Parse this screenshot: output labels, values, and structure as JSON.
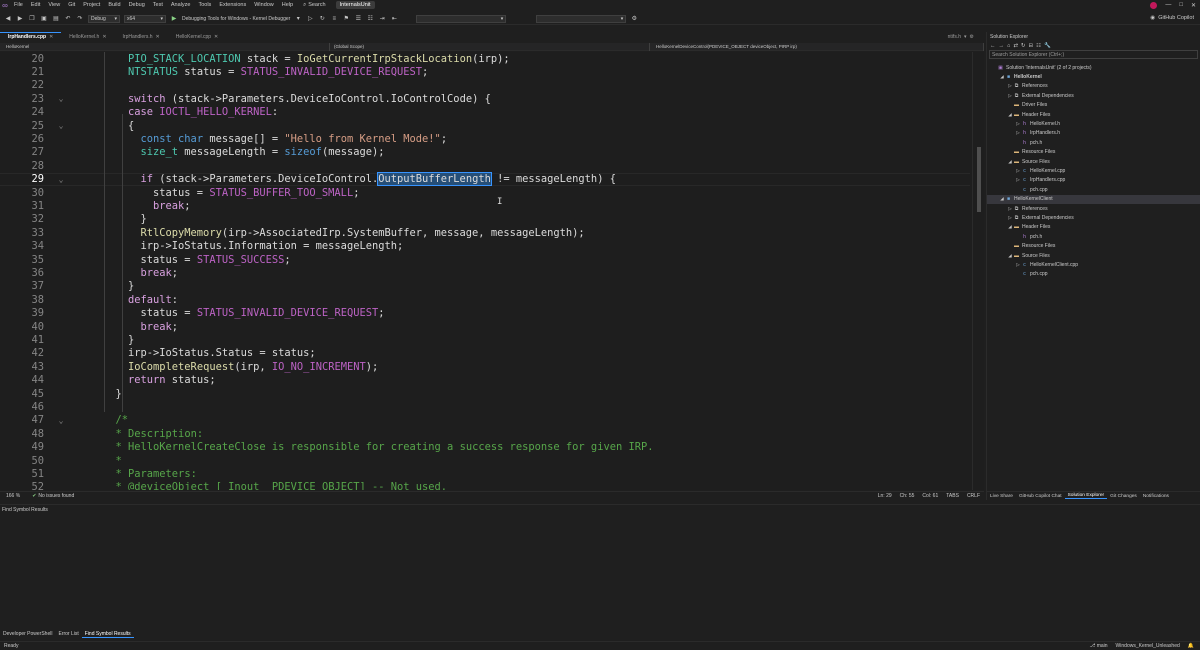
{
  "menubar": {
    "items": [
      "File",
      "Edit",
      "View",
      "Git",
      "Project",
      "Build",
      "Debug",
      "Test",
      "Analyze",
      "Tools",
      "Extensions",
      "Window",
      "Help"
    ],
    "search_label": "Search",
    "solution_name": "InternalsUnit"
  },
  "toolbar": {
    "config": "Debug",
    "platform": "x64",
    "debug_target": "Debugging Tools for Windows - Kernel Debugger",
    "copilot_label": "GitHub Copilot"
  },
  "doc_tabs": {
    "tabs": [
      {
        "label": "IrpHandlers.cpp",
        "active": true
      },
      {
        "label": "HelloKernel.h",
        "active": false
      },
      {
        "label": "IrpHandlers.h",
        "active": false
      },
      {
        "label": "HelloKernel.cpp",
        "active": false
      }
    ],
    "right_label": "ntifs.h"
  },
  "navbar": {
    "project": "HelloKernel",
    "scope": "(Global Scope)",
    "member": "HelloKernelDeviceControl(PDEVICE_OBJECT deviceObject, PIRP irp)"
  },
  "editor": {
    "current_line": "29",
    "lines": [
      {
        "n": "20",
        "tokens": [
          [
            "ty",
            "PIO_STACK_LOCATION"
          ],
          [
            "code",
            " stack = "
          ],
          [
            "fn",
            "IoGetCurrentIrpStackLocation"
          ],
          [
            "code",
            "(irp);"
          ]
        ]
      },
      {
        "n": "21",
        "tokens": [
          [
            "ty",
            "NTSTATUS"
          ],
          [
            "code",
            " status = "
          ],
          [
            "mac",
            "STATUS_INVALID_DEVICE_REQUEST"
          ],
          [
            "code",
            ";"
          ]
        ]
      },
      {
        "n": "22",
        "tokens": []
      },
      {
        "n": "23",
        "tokens": [
          [
            "kw2",
            "switch"
          ],
          [
            "code",
            " (stack->Parameters.DeviceIoControl.IoControlCode) {"
          ]
        ]
      },
      {
        "n": "24",
        "tokens": [
          [
            "kw2",
            "case"
          ],
          [
            "code",
            " "
          ],
          [
            "mac",
            "IOCTL_HELLO_KERNEL"
          ],
          [
            "code",
            ":"
          ]
        ]
      },
      {
        "n": "25",
        "tokens": [
          [
            "code",
            "{"
          ]
        ]
      },
      {
        "n": "26",
        "tokens": [
          [
            "kw",
            "const"
          ],
          [
            "code",
            " "
          ],
          [
            "kw",
            "char"
          ],
          [
            "code",
            " message[] = "
          ],
          [
            "str",
            "\"Hello from Kernel Mode!\""
          ],
          [
            "code",
            ";"
          ]
        ]
      },
      {
        "n": "27",
        "tokens": [
          [
            "ty",
            "size_t"
          ],
          [
            "code",
            " messageLength = "
          ],
          [
            "kw",
            "sizeof"
          ],
          [
            "code",
            "(message);"
          ]
        ]
      },
      {
        "n": "28",
        "tokens": []
      },
      {
        "n": "29",
        "tokens": [
          [
            "kw2",
            "if"
          ],
          [
            "code",
            " (stack->Parameters.DeviceIoControl."
          ],
          [
            "sel",
            "OutputBufferLength"
          ],
          [
            "code",
            " != messageLength) {"
          ]
        ]
      },
      {
        "n": "30",
        "tokens": [
          [
            "code",
            "status = "
          ],
          [
            "mac",
            "STATUS_BUFFER_TOO_SMALL"
          ],
          [
            "code",
            ";"
          ]
        ]
      },
      {
        "n": "31",
        "tokens": [
          [
            "kw2",
            "break"
          ],
          [
            "code",
            ";"
          ]
        ]
      },
      {
        "n": "32",
        "tokens": [
          [
            "code",
            "}"
          ]
        ]
      },
      {
        "n": "33",
        "tokens": [
          [
            "fn",
            "RtlCopyMemory"
          ],
          [
            "code",
            "(irp->AssociatedIrp.SystemBuffer, message, messageLength);"
          ]
        ]
      },
      {
        "n": "34",
        "tokens": [
          [
            "code",
            "irp->IoStatus.Information = messageLength;"
          ]
        ]
      },
      {
        "n": "35",
        "tokens": [
          [
            "code",
            "status = "
          ],
          [
            "mac",
            "STATUS_SUCCESS"
          ],
          [
            "code",
            ";"
          ]
        ]
      },
      {
        "n": "36",
        "tokens": [
          [
            "kw2",
            "break"
          ],
          [
            "code",
            ";"
          ]
        ]
      },
      {
        "n": "37",
        "tokens": [
          [
            "code",
            "}"
          ]
        ]
      },
      {
        "n": "38",
        "tokens": [
          [
            "kw2",
            "default"
          ],
          [
            "code",
            ":"
          ]
        ]
      },
      {
        "n": "39",
        "tokens": [
          [
            "code",
            "status = "
          ],
          [
            "mac",
            "STATUS_INVALID_DEVICE_REQUEST"
          ],
          [
            "code",
            ";"
          ]
        ]
      },
      {
        "n": "40",
        "tokens": [
          [
            "kw2",
            "break"
          ],
          [
            "code",
            ";"
          ]
        ]
      },
      {
        "n": "41",
        "tokens": [
          [
            "code",
            "}"
          ]
        ]
      },
      {
        "n": "42",
        "tokens": [
          [
            "code",
            "irp->IoStatus.Status = status;"
          ]
        ]
      },
      {
        "n": "43",
        "tokens": [
          [
            "fn",
            "IoCompleteRequest"
          ],
          [
            "code",
            "(irp, "
          ],
          [
            "mac",
            "IO_NO_INCREMENT"
          ],
          [
            "code",
            ");"
          ]
        ]
      },
      {
        "n": "44",
        "tokens": [
          [
            "kw2",
            "return"
          ],
          [
            "code",
            " status;"
          ]
        ]
      },
      {
        "n": "45",
        "tokens": [
          [
            "code",
            "}"
          ]
        ]
      },
      {
        "n": "46",
        "tokens": []
      },
      {
        "n": "47",
        "tokens": [
          [
            "cm",
            "/*"
          ]
        ]
      },
      {
        "n": "48",
        "tokens": [
          [
            "cm",
            "* Description:"
          ]
        ]
      },
      {
        "n": "49",
        "tokens": [
          [
            "cm",
            "* HelloKernelCreateClose is responsible for creating a success response for given IRP."
          ]
        ]
      },
      {
        "n": "50",
        "tokens": [
          [
            "cm",
            "*"
          ]
        ]
      },
      {
        "n": "51",
        "tokens": [
          [
            "cm",
            "* Parameters:"
          ]
        ]
      },
      {
        "n": "52",
        "tokens": [
          [
            "cm",
            "* @deviceObject [_Inout_ PDEVICE_OBJECT] -- Not used."
          ]
        ]
      }
    ]
  },
  "editor_status": {
    "zoom": "166 %",
    "issues": "No issues found",
    "line": "Ln: 29",
    "col": "Ch: 55",
    "colnum": "Col: 61",
    "tabs": "TABS",
    "eol": "CRLF"
  },
  "solution_explorer": {
    "title": "Solution Explorer",
    "search_placeholder": "Search Solution Explorer (Ctrl+;)",
    "items": [
      {
        "label": "Solution 'InternalsUnit' (2 of 2 projects)",
        "depth": 0,
        "icon": "solution-icon",
        "expanded": null
      },
      {
        "label": "HelloKernel",
        "depth": 1,
        "icon": "project-icon",
        "expanded": true,
        "bold": true
      },
      {
        "label": "References",
        "depth": 2,
        "icon": "references-icon",
        "expanded": false
      },
      {
        "label": "External Dependencies",
        "depth": 2,
        "icon": "external-deps-icon",
        "expanded": false
      },
      {
        "label": "Driver Files",
        "depth": 2,
        "icon": "folder-icon",
        "expanded": null
      },
      {
        "label": "Header Files",
        "depth": 2,
        "icon": "folder-icon",
        "expanded": true
      },
      {
        "label": "HelloKernel.h",
        "depth": 3,
        "icon": "header-file-icon",
        "expanded": false
      },
      {
        "label": "IrpHandlers.h",
        "depth": 3,
        "icon": "header-file-icon",
        "expanded": false
      },
      {
        "label": "pch.h",
        "depth": 3,
        "icon": "header-file-icon",
        "expanded": null
      },
      {
        "label": "Resource Files",
        "depth": 2,
        "icon": "folder-icon",
        "expanded": null
      },
      {
        "label": "Source Files",
        "depth": 2,
        "icon": "folder-icon",
        "expanded": true
      },
      {
        "label": "HelloKernel.cpp",
        "depth": 3,
        "icon": "cpp-file-icon",
        "expanded": false
      },
      {
        "label": "IrpHandlers.cpp",
        "depth": 3,
        "icon": "cpp-file-icon",
        "expanded": false
      },
      {
        "label": "pch.cpp",
        "depth": 3,
        "icon": "cpp-file-icon",
        "expanded": null
      },
      {
        "label": "HelloKernelClient",
        "depth": 1,
        "icon": "project-icon",
        "expanded": true,
        "selected": true
      },
      {
        "label": "References",
        "depth": 2,
        "icon": "references-icon",
        "expanded": false
      },
      {
        "label": "External Dependencies",
        "depth": 2,
        "icon": "external-deps-icon",
        "expanded": false
      },
      {
        "label": "Header Files",
        "depth": 2,
        "icon": "folder-icon",
        "expanded": true
      },
      {
        "label": "pch.h",
        "depth": 3,
        "icon": "header-file-icon",
        "expanded": null
      },
      {
        "label": "Resource Files",
        "depth": 2,
        "icon": "folder-icon",
        "expanded": null
      },
      {
        "label": "Source Files",
        "depth": 2,
        "icon": "folder-icon",
        "expanded": true
      },
      {
        "label": "HelloKernelClient.cpp",
        "depth": 3,
        "icon": "cpp-file-icon",
        "expanded": false
      },
      {
        "label": "pch.cpp",
        "depth": 3,
        "icon": "cpp-file-icon",
        "expanded": null
      }
    ],
    "tabs": [
      {
        "label": "Live Share",
        "active": false
      },
      {
        "label": "GitHub Copilot Chat",
        "active": false
      },
      {
        "label": "Solution Explorer",
        "active": true
      },
      {
        "label": "Git Changes",
        "active": false
      },
      {
        "label": "Notifications",
        "active": false
      }
    ]
  },
  "bottom_panel": {
    "title": "Find Symbol Results",
    "tabs": [
      {
        "label": "Developer PowerShell",
        "active": false
      },
      {
        "label": "Error List",
        "active": false
      },
      {
        "label": "Find Symbol Results",
        "active": true
      }
    ]
  },
  "statusbar": {
    "ready": "Ready",
    "branch": "main",
    "repo": "Windows_Kernel_Unleashed"
  },
  "colors": {
    "accent": "#3794ff",
    "background": "#1e1e1e",
    "selection": "#264f78"
  }
}
